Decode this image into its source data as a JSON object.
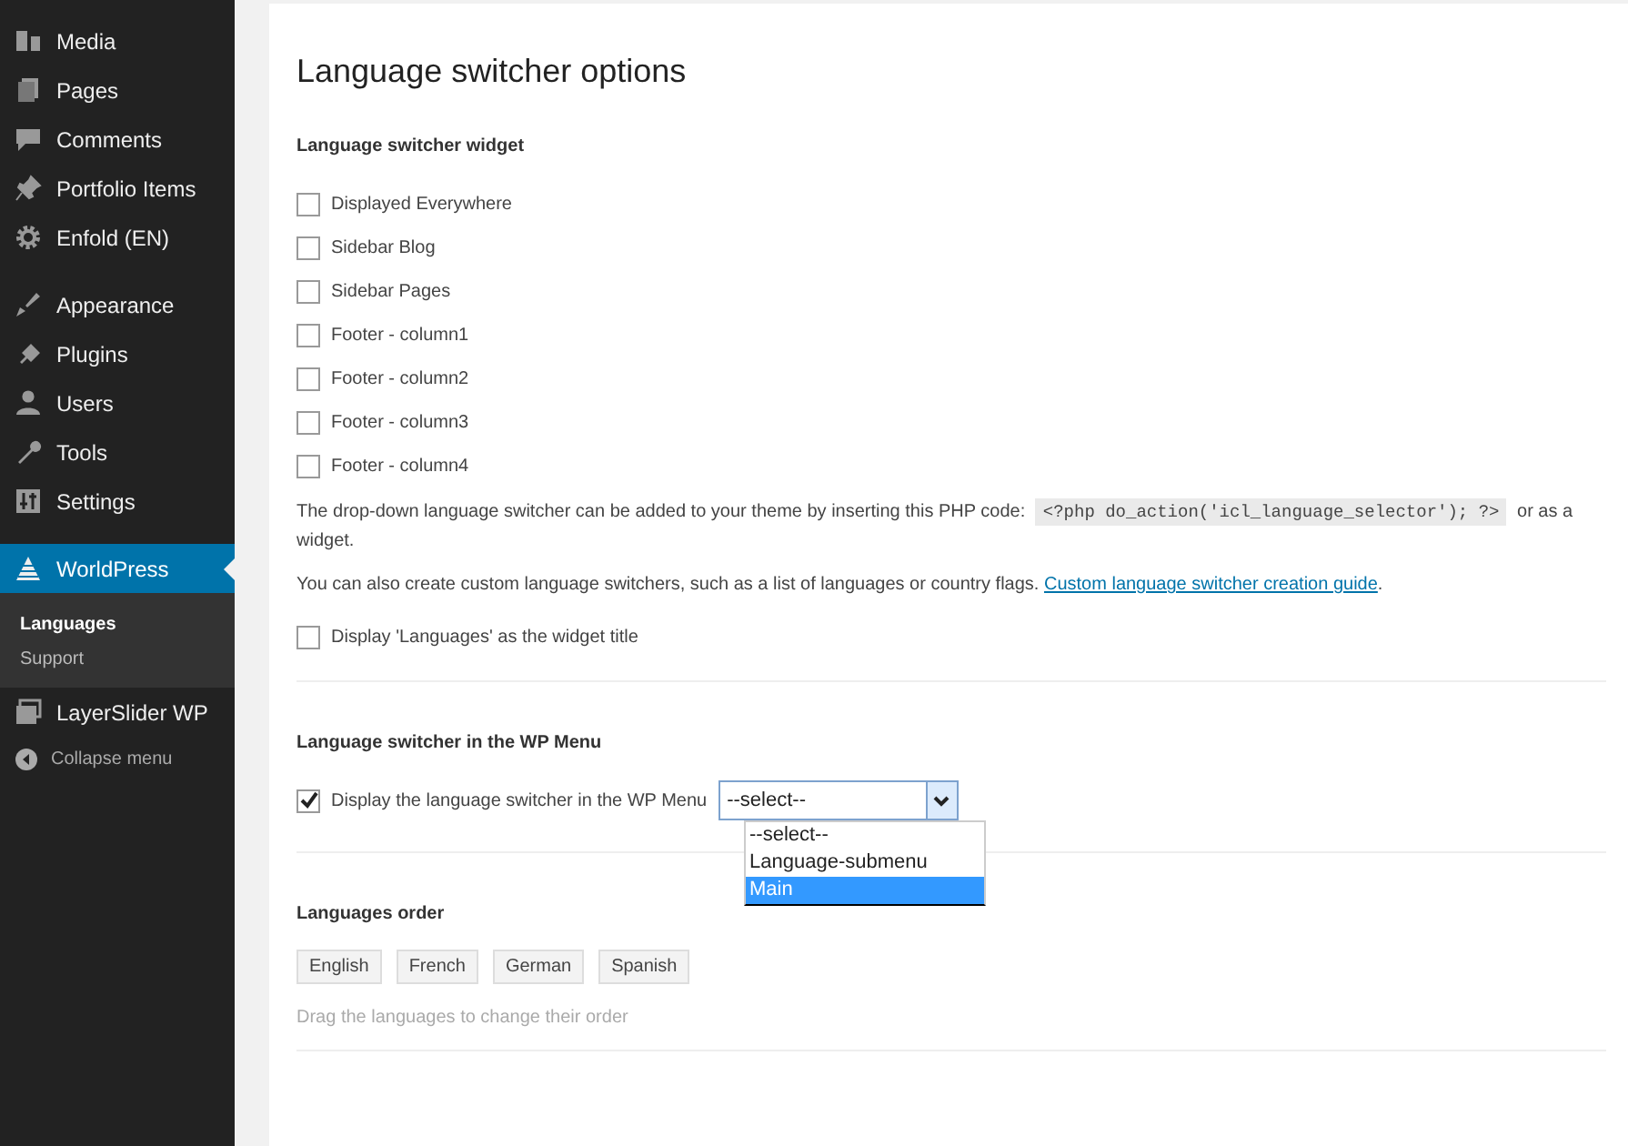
{
  "sidebar": {
    "groups": [
      [
        {
          "label": "Media",
          "selected": false
        },
        {
          "label": "Pages",
          "selected": false
        },
        {
          "label": "Comments",
          "selected": false
        },
        {
          "label": "Portfolio Items",
          "selected": false
        },
        {
          "label": "Enfold (EN)",
          "selected": false
        }
      ],
      [
        {
          "label": "Appearance",
          "selected": false
        },
        {
          "label": "Plugins",
          "selected": false
        },
        {
          "label": "Users",
          "selected": false
        },
        {
          "label": "Tools",
          "selected": false
        },
        {
          "label": "Settings",
          "selected": false
        }
      ],
      [
        {
          "label": "WorldPress",
          "selected": true,
          "children": [
            {
              "label": "Languages",
              "selected": true
            },
            {
              "label": "Support",
              "selected": false
            }
          ]
        },
        {
          "label": "LayerSlider WP",
          "selected": false
        }
      ]
    ],
    "collapse": "Collapse menu"
  },
  "page": {
    "title": "Language switcher options",
    "widget_section": {
      "heading": "Language switcher widget",
      "checkboxes": [
        {
          "label": "Displayed Everywhere",
          "checked": false
        },
        {
          "label": "Sidebar Blog",
          "checked": false
        },
        {
          "label": "Sidebar Pages",
          "checked": false
        },
        {
          "label": "Footer - column1",
          "checked": false
        },
        {
          "label": "Footer - column2",
          "checked": false
        },
        {
          "label": "Footer - column3",
          "checked": false
        },
        {
          "label": "Footer - column4",
          "checked": false
        }
      ],
      "php_note": {
        "before": "The drop-down language switcher can be added to your theme by inserting this PHP code:",
        "code": "<?php do_action('icl_language_selector'); ?>",
        "after": "or as a widget."
      },
      "custom_note": {
        "text": "You can also create custom language switchers, such as a list of languages or country flags.",
        "link": "Custom language switcher creation guide",
        "end": "."
      },
      "title_checkbox": {
        "label": "Display 'Languages' as the widget title",
        "checked": false
      }
    },
    "menu_section": {
      "heading": "Language switcher in the WP Menu",
      "checkbox": {
        "label": "Display the language switcher in the WP Menu",
        "checked": true
      },
      "dropdown": {
        "value": "--select--",
        "expanded": true,
        "options": [
          {
            "label": "--select--",
            "highlighted": false
          },
          {
            "label": "Language-submenu",
            "highlighted": false
          },
          {
            "label": "Main",
            "highlighted": true
          }
        ]
      }
    },
    "order_section": {
      "heading": "Languages order",
      "languages": [
        "English",
        "French",
        "German",
        "Spanish"
      ],
      "hint": "Drag the languages to change their order"
    }
  }
}
